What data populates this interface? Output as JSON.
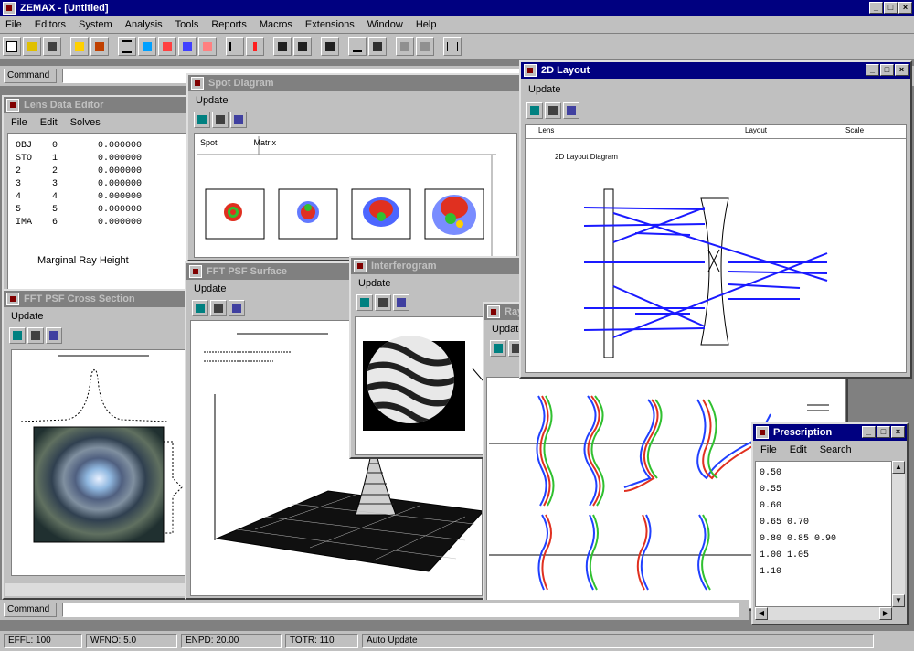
{
  "app": {
    "title": "ZEMAX - [Untitled]",
    "menu": [
      "File",
      "Editors",
      "System",
      "Analysis",
      "Tools",
      "Reports",
      "Macros",
      "Extensions",
      "Window",
      "Help"
    ]
  },
  "toolbar": {
    "buttons": [
      "new-icon",
      "open-icon",
      "save-icon",
      "layout-icon",
      "wavefront-icon",
      "spot-icon",
      "mtf-icon",
      "psf-icon",
      "ray-fan-icon",
      "opd-icon",
      "field-curvature-icon",
      "optimize-icon",
      "merit-icon",
      "tolerance-icon",
      "update-icon",
      "zoom-icon",
      "lens-data-icon",
      "extra-icon",
      "help-icon"
    ]
  },
  "command": {
    "label": "Command"
  },
  "lens_window": {
    "title": "Lens Data Editor",
    "menu": [
      "File",
      "Edit",
      "Solves"
    ],
    "rows": [
      {
        "col1": "OBJ",
        "col2": "0",
        "col3": "0.000000"
      },
      {
        "col1": "STO",
        "col2": "1",
        "col3": "0.000000"
      },
      {
        "col1": "2",
        "col2": "2",
        "col3": "0.000000"
      },
      {
        "col1": "3",
        "col2": "3",
        "col3": "0.000000"
      },
      {
        "col1": "4",
        "col2": "4",
        "col3": "0.000000"
      },
      {
        "col1": "5",
        "col2": "5",
        "col3": "0.000000"
      },
      {
        "col1": "IMA",
        "col2": "6",
        "col3": "0.000000"
      }
    ],
    "footer": "Marginal Ray Height"
  },
  "psf_window": {
    "title": "FFT PSF Cross Section",
    "menu": [
      "Update"
    ]
  },
  "spot_window": {
    "title": "Spot Diagram",
    "menu": [
      "Update"
    ],
    "tabs": [
      "Spot",
      "Matrix"
    ]
  },
  "psf3d_window": {
    "title": "FFT PSF Surface",
    "menu": [
      "Update"
    ]
  },
  "interf_window": {
    "title": "Interferogram",
    "menu": [
      "Update"
    ]
  },
  "layout_window": {
    "title": "2D Layout",
    "menu": [
      "Update"
    ],
    "header": [
      "Lens",
      "Layout",
      "Scale"
    ],
    "subtitle": "2D Layout Diagram"
  },
  "small_window": {
    "title": "Ray Fan",
    "menu": [
      "Update"
    ]
  },
  "text_window": {
    "title": "Prescription",
    "menu": [
      "File",
      "Edit",
      "Search"
    ],
    "lines": [
      "0.50",
      "0.55",
      "0.60",
      "0.65  0.70",
      "0.80  0.85  0.90",
      "1.00  1.05",
      "1.10"
    ]
  },
  "status": {
    "cells": [
      "EFFL: 100",
      "WFNO: 5.0",
      "ENPD: 20.00",
      "TOTR: 110",
      "Auto Update"
    ]
  },
  "colors": {
    "titlebar_active": "#000080",
    "titlebar_inactive": "#808080",
    "face": "#c0c0c0",
    "ray_blue": "#1a1aff"
  }
}
